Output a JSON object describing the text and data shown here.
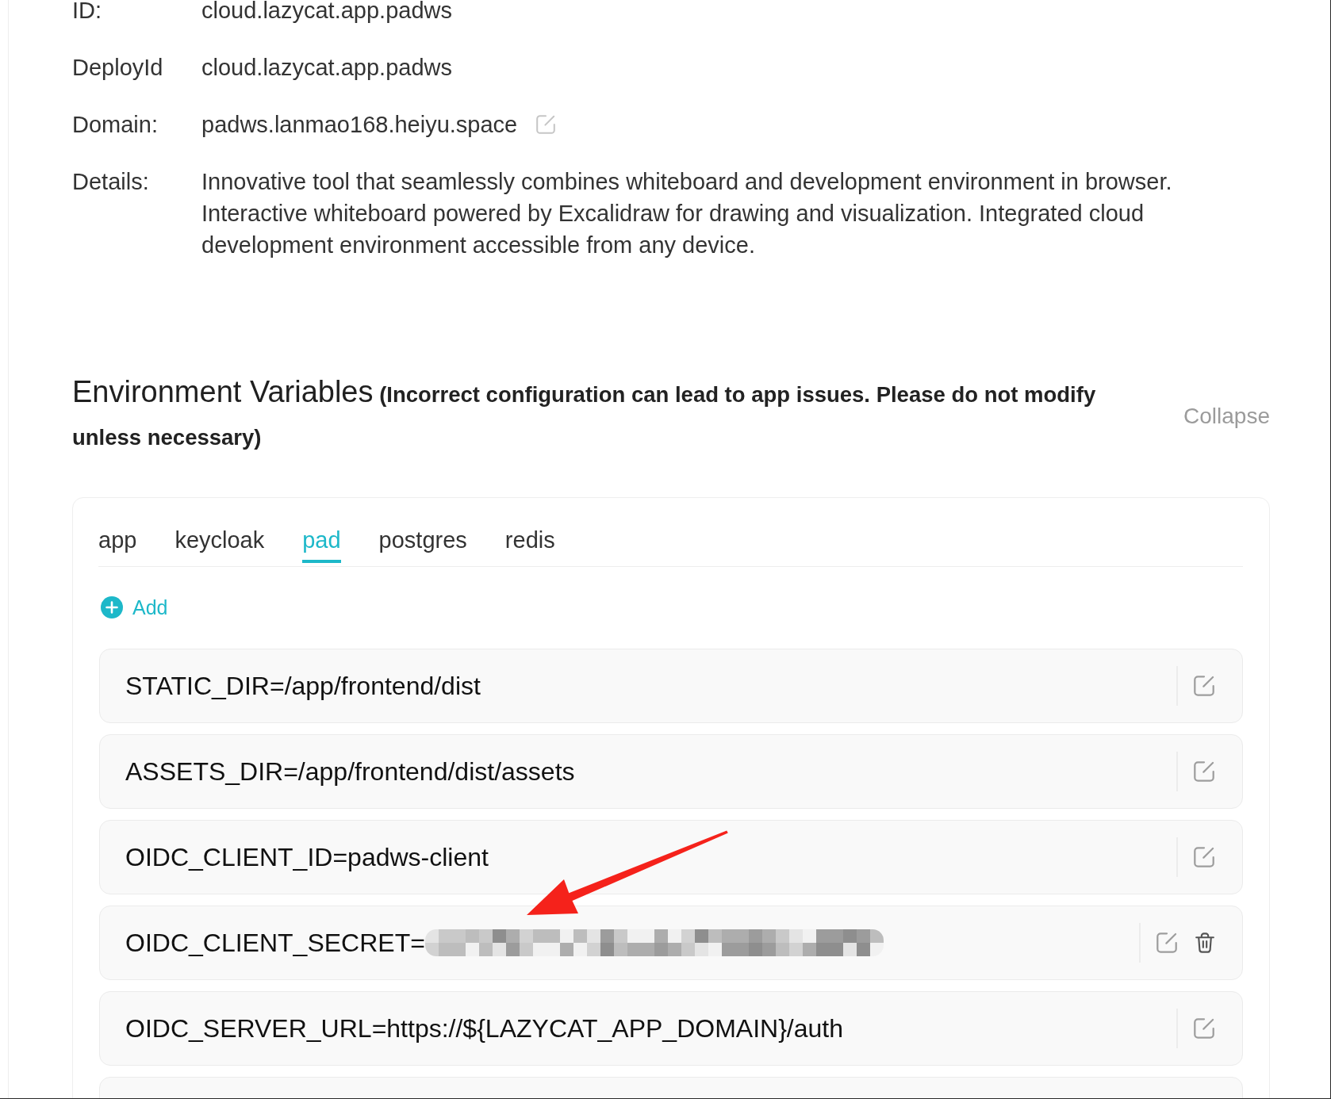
{
  "info": [
    {
      "label": "ID:",
      "value": "cloud.lazycat.app.padws",
      "editable": false
    },
    {
      "label": "DeployId",
      "value": "cloud.lazycat.app.padws",
      "editable": false
    },
    {
      "label": "Domain:",
      "value": "padws.lanmao168.heiyu.space",
      "editable": true
    },
    {
      "label": "Details:",
      "value": "Innovative tool that seamlessly combines whiteboard and development environment in browser. Interactive whiteboard powered by Excalidraw for drawing and visualization. Integrated cloud development environment accessible from any device.",
      "editable": false
    }
  ],
  "env": {
    "title": "Environment Variables",
    "note": "(Incorrect configuration can lead to app issues. Please do not modify unless necessary)",
    "collapse": "Collapse"
  },
  "tabs": [
    {
      "label": "app",
      "selected": false
    },
    {
      "label": "keycloak",
      "selected": false
    },
    {
      "label": "pad",
      "selected": true
    },
    {
      "label": "postgres",
      "selected": false
    },
    {
      "label": "redis",
      "selected": false
    }
  ],
  "add": {
    "label": "Add"
  },
  "variables": [
    {
      "text": "STATIC_DIR=/app/frontend/dist",
      "redacted": false,
      "deletable": false
    },
    {
      "text": "ASSETS_DIR=/app/frontend/dist/assets",
      "redacted": false,
      "deletable": false
    },
    {
      "text": "OIDC_CLIENT_ID=padws-client",
      "redacted": false,
      "deletable": false
    },
    {
      "text": "OIDC_CLIENT_SECRET=",
      "redacted": true,
      "deletable": true
    },
    {
      "text": "OIDC_SERVER_URL=https://${LAZYCAT_APP_DOMAIN}/auth",
      "redacted": false,
      "deletable": false
    }
  ],
  "more_rows_below": true,
  "annotations": [
    {
      "kind": "arrow"
    }
  ]
}
